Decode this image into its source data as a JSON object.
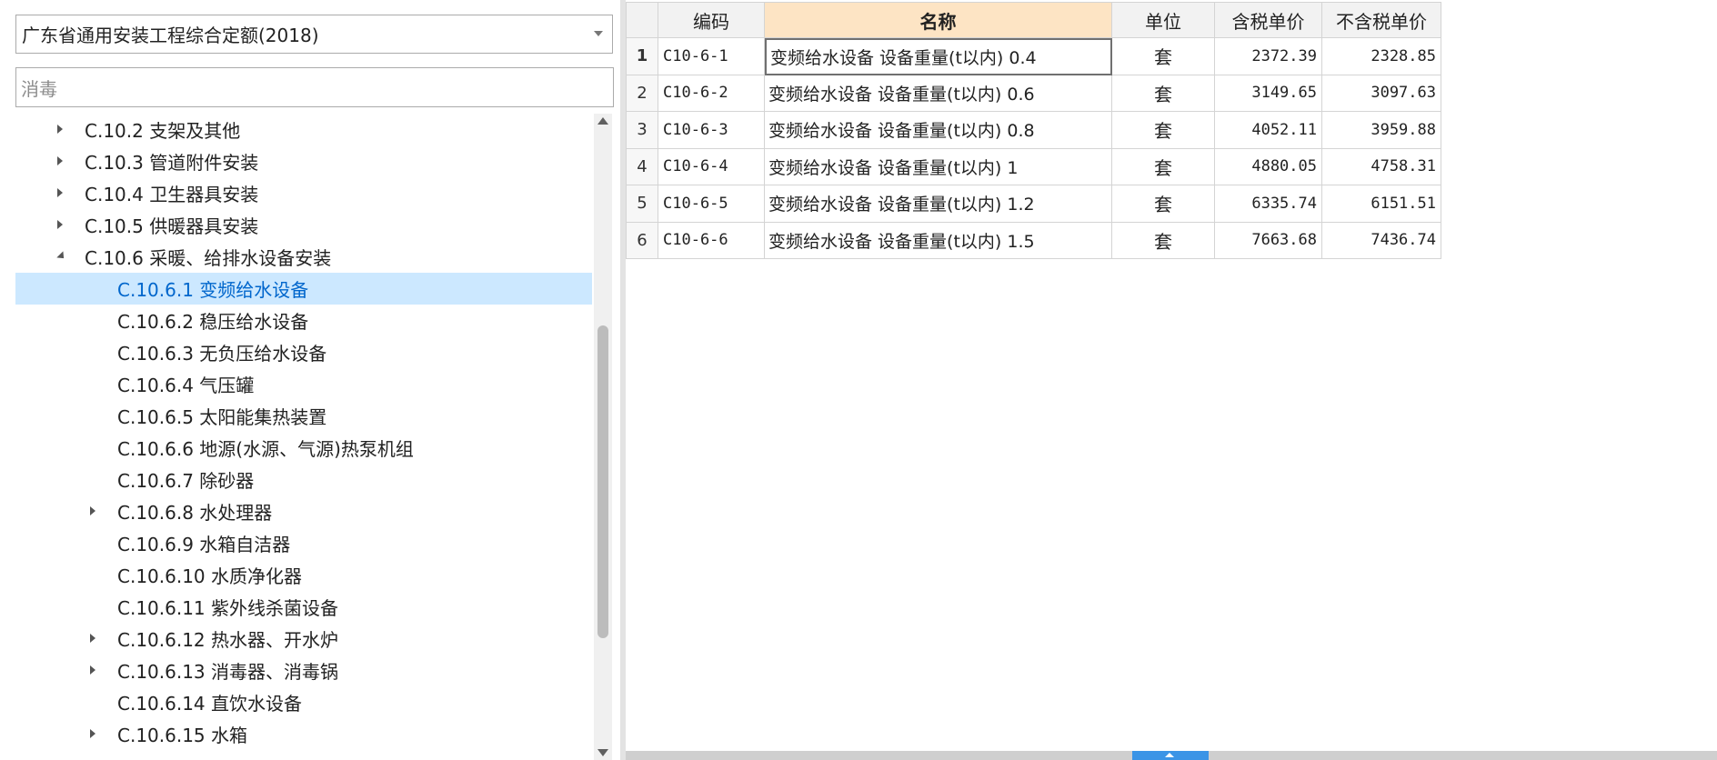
{
  "quota": {
    "selected": "广东省通用安装工程综合定额(2018)"
  },
  "search": {
    "value": "消毒"
  },
  "tree": {
    "items": [
      {
        "label": "C.10.2 支架及其他",
        "level": 1,
        "expander": "collapsed",
        "selected": false
      },
      {
        "label": "C.10.3 管道附件安装",
        "level": 1,
        "expander": "collapsed",
        "selected": false
      },
      {
        "label": "C.10.4 卫生器具安装",
        "level": 1,
        "expander": "collapsed",
        "selected": false
      },
      {
        "label": "C.10.5 供暖器具安装",
        "level": 1,
        "expander": "collapsed",
        "selected": false
      },
      {
        "label": "C.10.6 采暖、给排水设备安装",
        "level": 1,
        "expander": "expanded",
        "selected": false
      },
      {
        "label": "C.10.6.1 变频给水设备",
        "level": 2,
        "expander": "none",
        "selected": true
      },
      {
        "label": "C.10.6.2 稳压给水设备",
        "level": 2,
        "expander": "none",
        "selected": false
      },
      {
        "label": "C.10.6.3 无负压给水设备",
        "level": 2,
        "expander": "none",
        "selected": false
      },
      {
        "label": "C.10.6.4 气压罐",
        "level": 2,
        "expander": "none",
        "selected": false
      },
      {
        "label": "C.10.6.5 太阳能集热装置",
        "level": 2,
        "expander": "none",
        "selected": false
      },
      {
        "label": "C.10.6.6 地源(水源、气源)热泵机组",
        "level": 2,
        "expander": "none",
        "selected": false
      },
      {
        "label": "C.10.6.7 除砂器",
        "level": 2,
        "expander": "none",
        "selected": false
      },
      {
        "label": "C.10.6.8 水处理器",
        "level": 2,
        "expander": "collapsed",
        "selected": false
      },
      {
        "label": "C.10.6.9 水箱自洁器",
        "level": 2,
        "expander": "none",
        "selected": false
      },
      {
        "label": "C.10.6.10 水质净化器",
        "level": 2,
        "expander": "none",
        "selected": false
      },
      {
        "label": "C.10.6.11 紫外线杀菌设备",
        "level": 2,
        "expander": "none",
        "selected": false
      },
      {
        "label": "C.10.6.12 热水器、开水炉",
        "level": 2,
        "expander": "collapsed",
        "selected": false
      },
      {
        "label": "C.10.6.13 消毒器、消毒锅",
        "level": 2,
        "expander": "collapsed",
        "selected": false
      },
      {
        "label": "C.10.6.14 直饮水设备",
        "level": 2,
        "expander": "none",
        "selected": false
      },
      {
        "label": "C.10.6.15 水箱",
        "level": 2,
        "expander": "collapsed",
        "selected": false
      }
    ]
  },
  "grid": {
    "headers": {
      "code": "编码",
      "name": "名称",
      "unit": "单位",
      "tax_price": "含税单价",
      "notax_price": "不含税单价"
    },
    "rows": [
      {
        "no": "1",
        "code": "C10-6-1",
        "name": "变频给水设备 设备重量(t以内) 0.4",
        "unit": "套",
        "tax_price": "2372.39",
        "notax_price": "2328.85"
      },
      {
        "no": "2",
        "code": "C10-6-2",
        "name": "变频给水设备 设备重量(t以内) 0.6",
        "unit": "套",
        "tax_price": "3149.65",
        "notax_price": "3097.63"
      },
      {
        "no": "3",
        "code": "C10-6-3",
        "name": "变频给水设备 设备重量(t以内) 0.8",
        "unit": "套",
        "tax_price": "4052.11",
        "notax_price": "3959.88"
      },
      {
        "no": "4",
        "code": "C10-6-4",
        "name": "变频给水设备 设备重量(t以内) 1",
        "unit": "套",
        "tax_price": "4880.05",
        "notax_price": "4758.31"
      },
      {
        "no": "5",
        "code": "C10-6-5",
        "name": "变频给水设备 设备重量(t以内) 1.2",
        "unit": "套",
        "tax_price": "6335.74",
        "notax_price": "6151.51"
      },
      {
        "no": "6",
        "code": "C10-6-6",
        "name": "变频给水设备 设备重量(t以内) 1.5",
        "unit": "套",
        "tax_price": "7663.68",
        "notax_price": "7436.74"
      }
    ]
  },
  "colors": {
    "selected_bg": "#cce8ff",
    "selected_text": "#0066cc",
    "active_header": "#fde4c4",
    "scroll_thumb": "#3b94e6"
  }
}
